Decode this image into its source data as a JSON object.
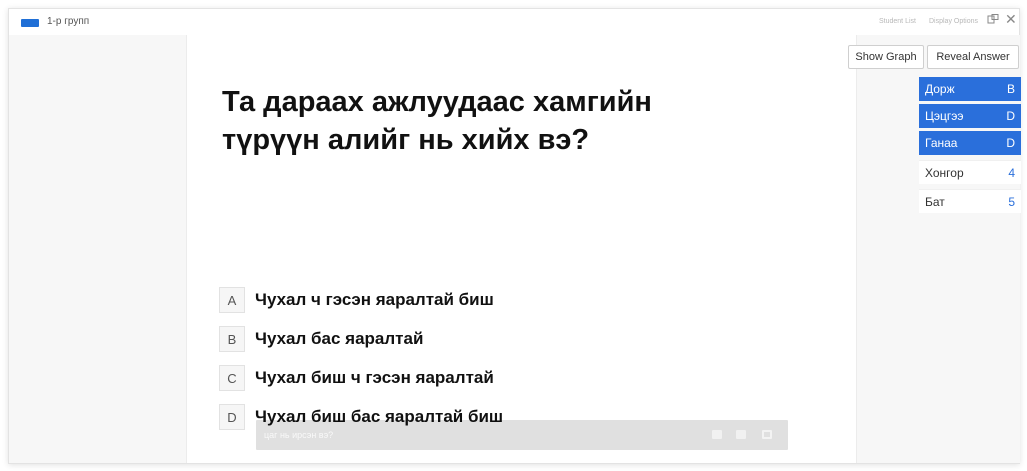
{
  "header": {
    "group_name": "1-р групп",
    "student_list": "Student List",
    "display_options": "Display Options",
    "window_icon": "window-mode-icon",
    "close_icon": "close-icon"
  },
  "slide": {
    "question": "Та дараах ажлуудаас хамгийн түрүүн алийг нь хийх вэ?",
    "options": [
      {
        "letter": "A",
        "text": "Чухал ч гэсэн яаралтай биш"
      },
      {
        "letter": "B",
        "text": "Чухал бас яаралтай"
      },
      {
        "letter": "C",
        "text": "Чухал биш ч гэсэн яаралтай"
      },
      {
        "letter": "D",
        "text": "Чухал биш бас яаралтай биш"
      }
    ],
    "video_title": "цаг нь ирсэн вэ?"
  },
  "panel": {
    "show_graph": "Show Graph",
    "reveal_answer": "Reveal Answer",
    "students": [
      {
        "name": "Дорж",
        "value": "B",
        "state": "answered"
      },
      {
        "name": "Цэцгээ",
        "value": "D",
        "state": "answered"
      },
      {
        "name": "Ганаа",
        "value": "D",
        "state": "answered"
      },
      {
        "name": "Хонгор",
        "value": "4",
        "state": "pending"
      },
      {
        "name": "Бат",
        "value": "5",
        "state": "pending"
      }
    ]
  },
  "colors": {
    "accent": "#2a6fdb",
    "panel_bg": "#f7f7f7"
  }
}
